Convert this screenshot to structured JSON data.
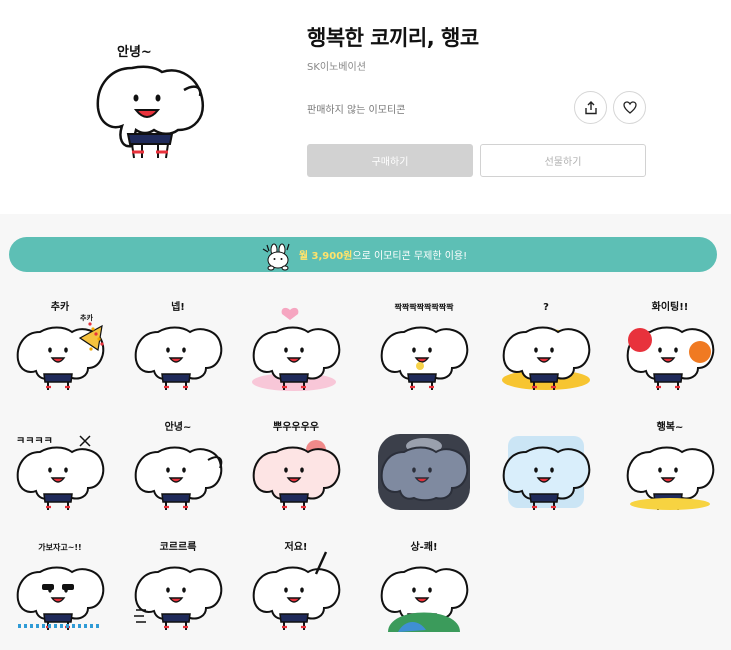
{
  "product": {
    "title": "행복한 코끼리, 행코",
    "publisher": "SK이노베이션",
    "status": "판매하지 않는 이모티콘",
    "hero_caption": "안녕~"
  },
  "actions": {
    "share_icon": "share-icon",
    "like_icon": "heart-icon",
    "buy_label": "구매하기",
    "gift_label": "선물하기"
  },
  "banner": {
    "price": "월 3,900원",
    "suffix": "으로 이모티콘 무제한 이용!"
  },
  "colors": {
    "banner": "#5dbfb5",
    "price_highlight": "#ffe36b",
    "uniform_navy": "#1f2a5a",
    "accent_red": "#e8323c"
  },
  "stickers": [
    {
      "caption": "추카",
      "caption2": "추카",
      "prop": "party"
    },
    {
      "caption": "넵!",
      "prop": "none"
    },
    {
      "caption": "",
      "prop": "heart"
    },
    {
      "caption": "짝짝짝짝짝짝짝짝",
      "prop": "clap"
    },
    {
      "caption": "?",
      "prop": "gold"
    },
    {
      "caption": "화이팅!!",
      "prop": "pompom"
    },
    {
      "caption": "ㅋㅋㅋㅋ",
      "prop": "laugh"
    },
    {
      "caption": "안녕~",
      "prop": "wave"
    },
    {
      "caption": "뿌우우우우",
      "prop": "pink"
    },
    {
      "caption": "",
      "prop": "gloom"
    },
    {
      "caption": "",
      "prop": "ice"
    },
    {
      "caption": "행복~",
      "prop": "happy"
    },
    {
      "caption": "가보자고~!!",
      "prop": "sunglasses"
    },
    {
      "caption": "코르르륵",
      "prop": "sleep"
    },
    {
      "caption": "저요!",
      "prop": "raise"
    },
    {
      "caption": "상-쾌!",
      "prop": "earth"
    }
  ]
}
